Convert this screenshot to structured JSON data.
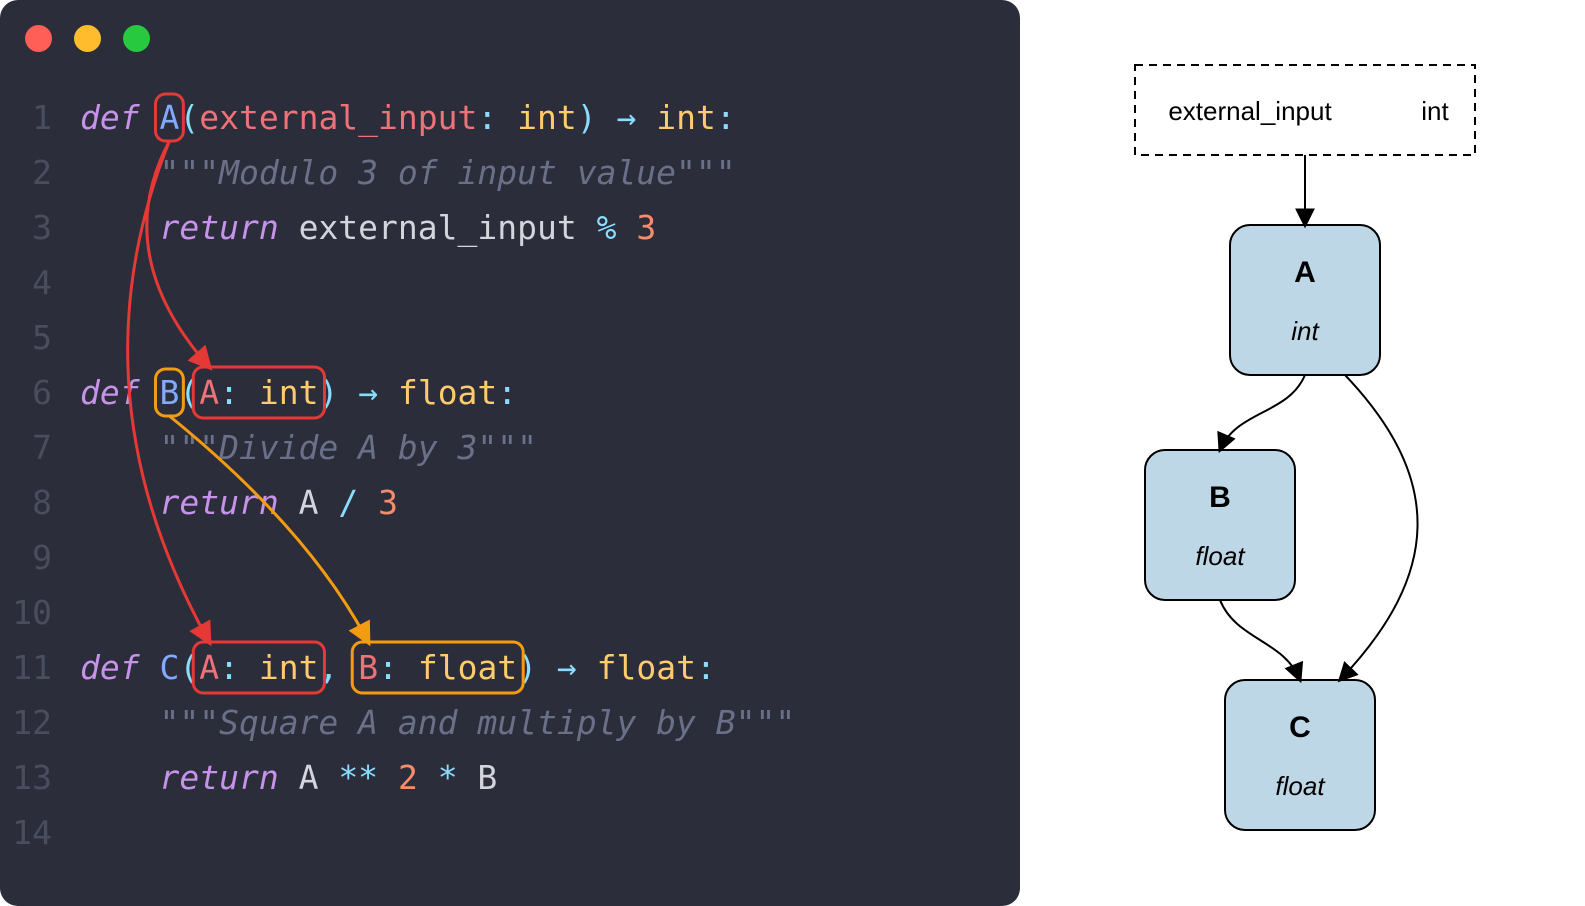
{
  "code": {
    "lines": [
      {
        "n": "1",
        "tokens": [
          {
            "t": "def ",
            "c": "kw"
          },
          {
            "t": "A",
            "c": "fn",
            "id": "fnA"
          },
          {
            "t": "(",
            "c": "punct"
          },
          {
            "t": "external_input",
            "c": "param"
          },
          {
            "t": ":",
            "c": "punct"
          },
          {
            "t": " int",
            "c": "type"
          },
          {
            "t": ")",
            "c": "punct"
          },
          {
            "t": " → ",
            "c": "op"
          },
          {
            "t": "int",
            "c": "type"
          },
          {
            "t": ":",
            "c": "punct"
          }
        ]
      },
      {
        "n": "2",
        "tokens": [
          {
            "t": "    ",
            "c": ""
          },
          {
            "t": "\"\"\"Modulo 3 of input value\"\"\"",
            "c": "str"
          }
        ]
      },
      {
        "n": "3",
        "tokens": [
          {
            "t": "    ",
            "c": ""
          },
          {
            "t": "return",
            "c": "kw"
          },
          {
            "t": " external_input ",
            "c": ""
          },
          {
            "t": "%",
            "c": "op"
          },
          {
            "t": " ",
            "c": ""
          },
          {
            "t": "3",
            "c": "num"
          }
        ]
      },
      {
        "n": "4",
        "tokens": []
      },
      {
        "n": "5",
        "tokens": []
      },
      {
        "n": "6",
        "tokens": [
          {
            "t": "def ",
            "c": "kw"
          },
          {
            "t": "B",
            "c": "fn",
            "id": "fnB"
          },
          {
            "t": "(",
            "c": "punct"
          },
          {
            "t": "A",
            "c": "param",
            "id": "pB_A"
          },
          {
            "t": ":",
            "c": "punct",
            "id": "pB_col"
          },
          {
            "t": " int",
            "c": "type",
            "id": "pB_int"
          },
          {
            "t": ")",
            "c": "punct"
          },
          {
            "t": " → ",
            "c": "op"
          },
          {
            "t": "float",
            "c": "type"
          },
          {
            "t": ":",
            "c": "punct"
          }
        ]
      },
      {
        "n": "7",
        "tokens": [
          {
            "t": "    ",
            "c": ""
          },
          {
            "t": "\"\"\"Divide A by 3\"\"\"",
            "c": "str"
          }
        ]
      },
      {
        "n": "8",
        "tokens": [
          {
            "t": "    ",
            "c": ""
          },
          {
            "t": "return",
            "c": "kw"
          },
          {
            "t": " A ",
            "c": ""
          },
          {
            "t": "/",
            "c": "op"
          },
          {
            "t": " ",
            "c": ""
          },
          {
            "t": "3",
            "c": "num"
          }
        ]
      },
      {
        "n": "9",
        "tokens": []
      },
      {
        "n": "10",
        "tokens": []
      },
      {
        "n": "11",
        "tokens": [
          {
            "t": "def ",
            "c": "kw"
          },
          {
            "t": "C",
            "c": "fn"
          },
          {
            "t": "(",
            "c": "punct"
          },
          {
            "t": "A",
            "c": "param",
            "id": "pC_A"
          },
          {
            "t": ":",
            "c": "punct",
            "id": "pC_col1"
          },
          {
            "t": " int",
            "c": "type",
            "id": "pC_int"
          },
          {
            "t": ",",
            "c": "punct"
          },
          {
            "t": " ",
            "c": ""
          },
          {
            "t": "B",
            "c": "param",
            "id": "pC_B"
          },
          {
            "t": ":",
            "c": "punct",
            "id": "pC_col2"
          },
          {
            "t": " float",
            "c": "type",
            "id": "pC_float"
          },
          {
            "t": ")",
            "c": "punct"
          },
          {
            "t": " → ",
            "c": "op"
          },
          {
            "t": "float",
            "c": "type"
          },
          {
            "t": ":",
            "c": "punct"
          }
        ]
      },
      {
        "n": "12",
        "tokens": [
          {
            "t": "    ",
            "c": ""
          },
          {
            "t": "\"\"\"Square A and multiply by B\"\"\"",
            "c": "str"
          }
        ]
      },
      {
        "n": "13",
        "tokens": [
          {
            "t": "    ",
            "c": ""
          },
          {
            "t": "return",
            "c": "kw"
          },
          {
            "t": " A ",
            "c": ""
          },
          {
            "t": "**",
            "c": "op"
          },
          {
            "t": " ",
            "c": ""
          },
          {
            "t": "2",
            "c": "num"
          },
          {
            "t": " ",
            "c": ""
          },
          {
            "t": "*",
            "c": "op"
          },
          {
            "t": " B",
            "c": ""
          }
        ]
      },
      {
        "n": "14",
        "tokens": []
      }
    ]
  },
  "annotations": {
    "colors": {
      "red": "#e53935",
      "orange": "#f39c12"
    },
    "boxes": [
      {
        "around": "fnA",
        "pad": 4,
        "color": "red"
      },
      {
        "around": "fnB",
        "pad": 4,
        "color": "orange"
      },
      {
        "around": [
          "pB_A",
          "pB_col",
          "pB_int"
        ],
        "pad": 6,
        "color": "red"
      },
      {
        "around": [
          "pC_A",
          "pC_col1",
          "pC_int"
        ],
        "pad": 6,
        "color": "red"
      },
      {
        "around": [
          "pC_B",
          "pC_col2",
          "pC_float"
        ],
        "pad": 6,
        "color": "orange"
      }
    ],
    "arrows": [
      {
        "from": "fnA",
        "to": "pB_A",
        "color": "red",
        "bend": -80
      },
      {
        "from": "fnA",
        "to": "pC_A",
        "color": "red",
        "bend": -120
      },
      {
        "from": "fnB",
        "to": "pC_B",
        "color": "orange",
        "bend": 40
      }
    ]
  },
  "diagram": {
    "input": {
      "label": "external_input",
      "type": "int"
    },
    "nodes": [
      {
        "id": "A",
        "label": "A",
        "type": "int"
      },
      {
        "id": "B",
        "label": "B",
        "type": "float"
      },
      {
        "id": "C",
        "label": "C",
        "type": "float"
      }
    ],
    "edges": [
      {
        "from": "input",
        "to": "A"
      },
      {
        "from": "A",
        "to": "B"
      },
      {
        "from": "A",
        "to": "C"
      },
      {
        "from": "B",
        "to": "C"
      }
    ]
  }
}
